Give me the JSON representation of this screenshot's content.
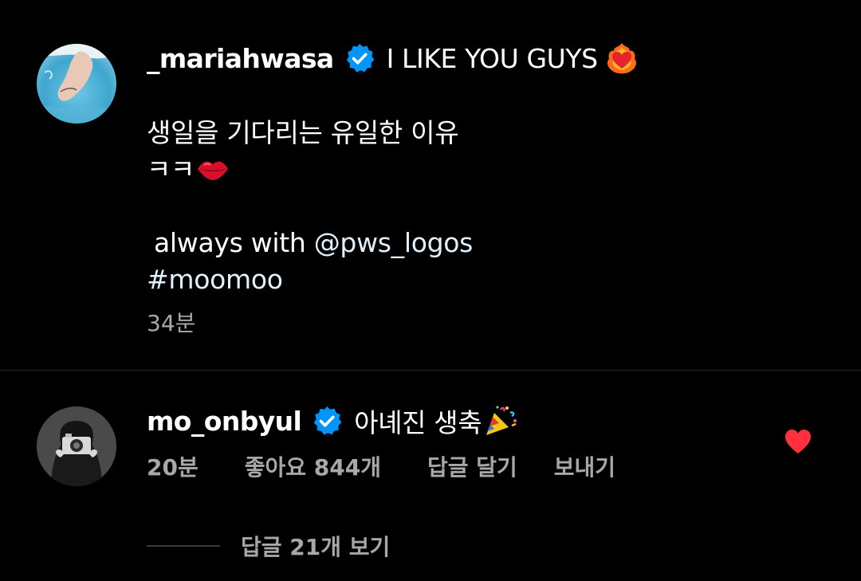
{
  "caption": {
    "username": "_mariahwasa",
    "headline": "I LIKE YOU GUYS",
    "line_korean": "생일을 기다리는 유일한 이유",
    "line_laugh": "ㅋㅋ",
    "always_prefix": "always with ",
    "mention": "@pws_logos",
    "hashtag": "#moomoo",
    "timestamp": "34분",
    "emojis": [
      "heart-on-fire-icon",
      "kiss-lips-icon"
    ]
  },
  "comment": {
    "username": "mo_onbyul",
    "text": "아녜진 생축",
    "emoji": "party-popper-icon",
    "time": "20분",
    "likes": "좋아요 844개",
    "reply_label": "답글 달기",
    "send_label": "보내기",
    "liked": true,
    "view_replies": "답글 21개 보기"
  },
  "colors": {
    "background": "#000000",
    "text_primary": "#ffffff",
    "text_secondary": "#a8a8a8",
    "link": "#e0f1ff",
    "verified_badge": "#0095f6",
    "like_red": "#ff3040",
    "divider": "#262626"
  }
}
